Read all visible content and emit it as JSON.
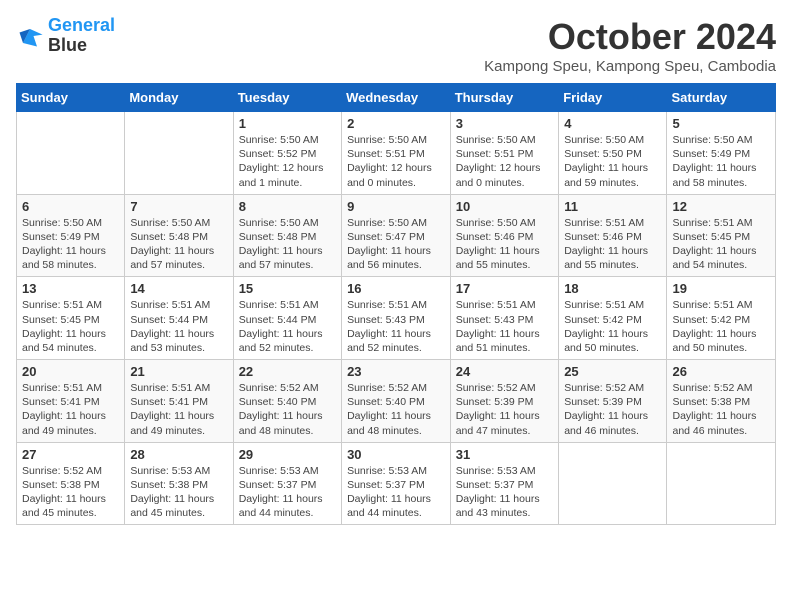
{
  "header": {
    "logo_line1": "General",
    "logo_line2": "Blue",
    "month": "October 2024",
    "location": "Kampong Speu, Kampong Speu, Cambodia"
  },
  "weekdays": [
    "Sunday",
    "Monday",
    "Tuesday",
    "Wednesday",
    "Thursday",
    "Friday",
    "Saturday"
  ],
  "weeks": [
    [
      {
        "day": "",
        "info": ""
      },
      {
        "day": "",
        "info": ""
      },
      {
        "day": "1",
        "info": "Sunrise: 5:50 AM\nSunset: 5:52 PM\nDaylight: 12 hours\nand 1 minute."
      },
      {
        "day": "2",
        "info": "Sunrise: 5:50 AM\nSunset: 5:51 PM\nDaylight: 12 hours\nand 0 minutes."
      },
      {
        "day": "3",
        "info": "Sunrise: 5:50 AM\nSunset: 5:51 PM\nDaylight: 12 hours\nand 0 minutes."
      },
      {
        "day": "4",
        "info": "Sunrise: 5:50 AM\nSunset: 5:50 PM\nDaylight: 11 hours\nand 59 minutes."
      },
      {
        "day": "5",
        "info": "Sunrise: 5:50 AM\nSunset: 5:49 PM\nDaylight: 11 hours\nand 58 minutes."
      }
    ],
    [
      {
        "day": "6",
        "info": "Sunrise: 5:50 AM\nSunset: 5:49 PM\nDaylight: 11 hours\nand 58 minutes."
      },
      {
        "day": "7",
        "info": "Sunrise: 5:50 AM\nSunset: 5:48 PM\nDaylight: 11 hours\nand 57 minutes."
      },
      {
        "day": "8",
        "info": "Sunrise: 5:50 AM\nSunset: 5:48 PM\nDaylight: 11 hours\nand 57 minutes."
      },
      {
        "day": "9",
        "info": "Sunrise: 5:50 AM\nSunset: 5:47 PM\nDaylight: 11 hours\nand 56 minutes."
      },
      {
        "day": "10",
        "info": "Sunrise: 5:50 AM\nSunset: 5:46 PM\nDaylight: 11 hours\nand 55 minutes."
      },
      {
        "day": "11",
        "info": "Sunrise: 5:51 AM\nSunset: 5:46 PM\nDaylight: 11 hours\nand 55 minutes."
      },
      {
        "day": "12",
        "info": "Sunrise: 5:51 AM\nSunset: 5:45 PM\nDaylight: 11 hours\nand 54 minutes."
      }
    ],
    [
      {
        "day": "13",
        "info": "Sunrise: 5:51 AM\nSunset: 5:45 PM\nDaylight: 11 hours\nand 54 minutes."
      },
      {
        "day": "14",
        "info": "Sunrise: 5:51 AM\nSunset: 5:44 PM\nDaylight: 11 hours\nand 53 minutes."
      },
      {
        "day": "15",
        "info": "Sunrise: 5:51 AM\nSunset: 5:44 PM\nDaylight: 11 hours\nand 52 minutes."
      },
      {
        "day": "16",
        "info": "Sunrise: 5:51 AM\nSunset: 5:43 PM\nDaylight: 11 hours\nand 52 minutes."
      },
      {
        "day": "17",
        "info": "Sunrise: 5:51 AM\nSunset: 5:43 PM\nDaylight: 11 hours\nand 51 minutes."
      },
      {
        "day": "18",
        "info": "Sunrise: 5:51 AM\nSunset: 5:42 PM\nDaylight: 11 hours\nand 50 minutes."
      },
      {
        "day": "19",
        "info": "Sunrise: 5:51 AM\nSunset: 5:42 PM\nDaylight: 11 hours\nand 50 minutes."
      }
    ],
    [
      {
        "day": "20",
        "info": "Sunrise: 5:51 AM\nSunset: 5:41 PM\nDaylight: 11 hours\nand 49 minutes."
      },
      {
        "day": "21",
        "info": "Sunrise: 5:51 AM\nSunset: 5:41 PM\nDaylight: 11 hours\nand 49 minutes."
      },
      {
        "day": "22",
        "info": "Sunrise: 5:52 AM\nSunset: 5:40 PM\nDaylight: 11 hours\nand 48 minutes."
      },
      {
        "day": "23",
        "info": "Sunrise: 5:52 AM\nSunset: 5:40 PM\nDaylight: 11 hours\nand 48 minutes."
      },
      {
        "day": "24",
        "info": "Sunrise: 5:52 AM\nSunset: 5:39 PM\nDaylight: 11 hours\nand 47 minutes."
      },
      {
        "day": "25",
        "info": "Sunrise: 5:52 AM\nSunset: 5:39 PM\nDaylight: 11 hours\nand 46 minutes."
      },
      {
        "day": "26",
        "info": "Sunrise: 5:52 AM\nSunset: 5:38 PM\nDaylight: 11 hours\nand 46 minutes."
      }
    ],
    [
      {
        "day": "27",
        "info": "Sunrise: 5:52 AM\nSunset: 5:38 PM\nDaylight: 11 hours\nand 45 minutes."
      },
      {
        "day": "28",
        "info": "Sunrise: 5:53 AM\nSunset: 5:38 PM\nDaylight: 11 hours\nand 45 minutes."
      },
      {
        "day": "29",
        "info": "Sunrise: 5:53 AM\nSunset: 5:37 PM\nDaylight: 11 hours\nand 44 minutes."
      },
      {
        "day": "30",
        "info": "Sunrise: 5:53 AM\nSunset: 5:37 PM\nDaylight: 11 hours\nand 44 minutes."
      },
      {
        "day": "31",
        "info": "Sunrise: 5:53 AM\nSunset: 5:37 PM\nDaylight: 11 hours\nand 43 minutes."
      },
      {
        "day": "",
        "info": ""
      },
      {
        "day": "",
        "info": ""
      }
    ]
  ]
}
